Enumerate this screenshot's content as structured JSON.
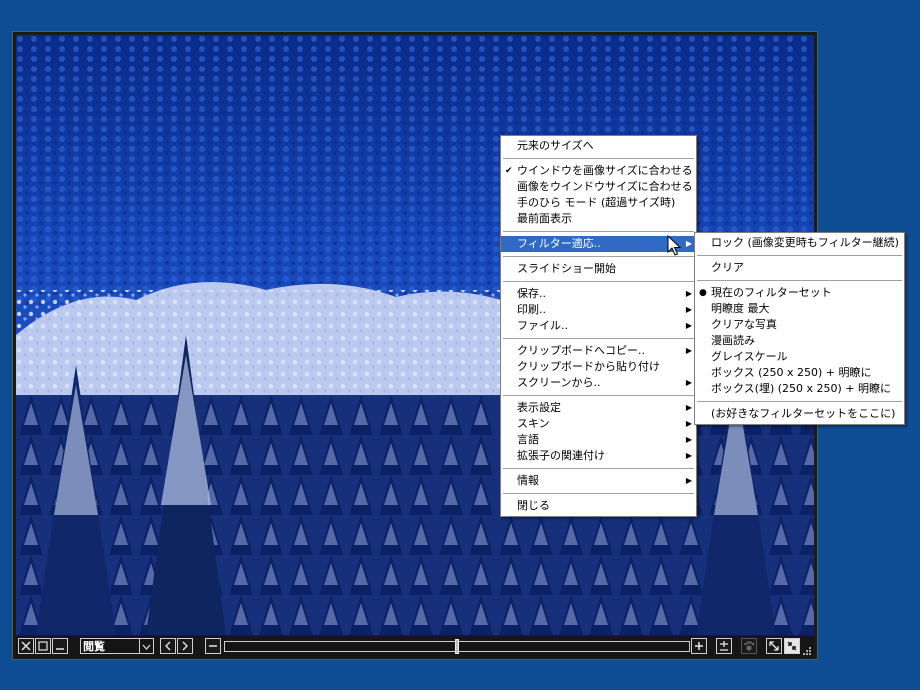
{
  "toolbar": {
    "view_mode": "閲覧"
  },
  "context_menu": {
    "original_size": "元来のサイズへ",
    "fit_window_to_image": "ウインドウを画像サイズに合わせる",
    "fit_image_to_window": "画像をウインドウサイズに合わせる",
    "hand_mode": "手のひら モード (超過サイズ時)",
    "always_on_top": "最前面表示",
    "apply_filter": "フィルター適応..",
    "slideshow": "スライドショー開始",
    "save": "保存..",
    "print": "印刷..",
    "file": "ファイル..",
    "copy_clipboard": "クリップボードへコピー..",
    "paste_clipboard": "クリップボードから貼り付け",
    "from_screen": "スクリーンから..",
    "display_settings": "表示設定",
    "skin": "スキン",
    "language": "言語",
    "file_association": "拡張子の関連付け",
    "info": "情報",
    "close": "閉じる"
  },
  "filter_menu": {
    "lock": "ロック (画像変更時もフィルター継続)",
    "clear": "クリア",
    "current_set": "現在のフィルターセット",
    "max_sharpness": "明瞭度 最大",
    "clear_photo": "クリアな写真",
    "manga": "漫画読み",
    "grayscale": "グレイスケール",
    "box": "ボックス (250 x 250) + 明瞭に",
    "box_fill": "ボックス(埋) (250 x 250) + 明瞭に",
    "favorite": "(お好きなフィルターセットをここに)"
  },
  "colors": {
    "desktop": "#0e4d94",
    "highlight": "#316ac5"
  }
}
